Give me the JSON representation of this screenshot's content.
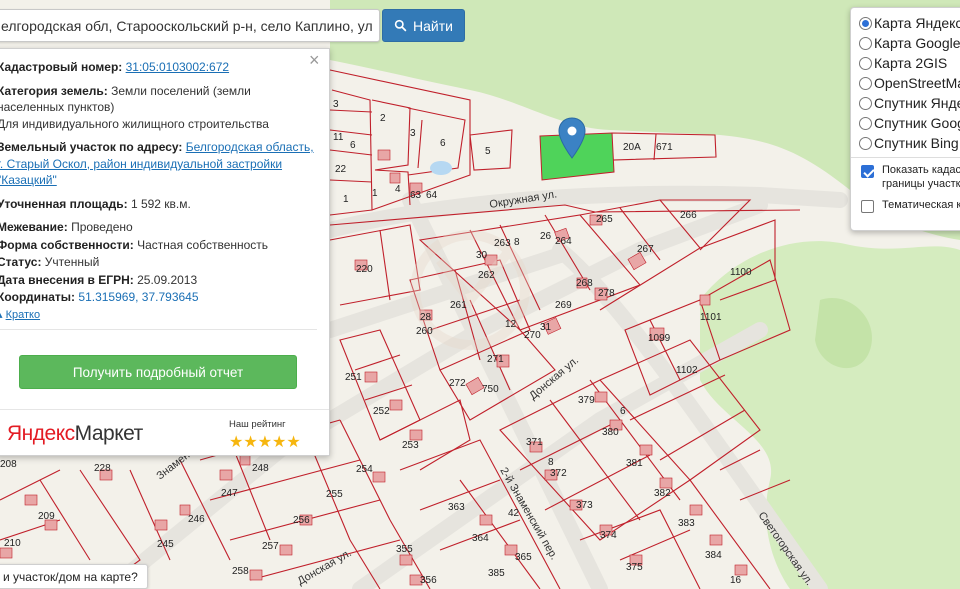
{
  "search": {
    "value": "елгородская обл, Старооскольский р-н, село Каплино, ул",
    "button_label": "Найти"
  },
  "info": {
    "cadastral_label": "Кадастровый номер:",
    "cadastral_value": "31:05:0103002:672",
    "category_label": "Категория земель:",
    "category_value": "Земли поселений (земли",
    "category_value2": "населенных пунктов)",
    "purpose_value": "Для индивидуального жилищного строительства",
    "address_label": "Земельный участок по адресу:",
    "address_line1": "Белгородская область,",
    "address_line2": "г. Старый Оскол, район индивидуальной застройки",
    "address_line3": "\"Казацкий\"",
    "area_label": "Уточненная площадь:",
    "area_value": "1 592 кв.м.",
    "survey_label": "Межевание:",
    "survey_value": "Проведено",
    "ownership_label": "Форма собственности:",
    "ownership_value": "Частная собственность",
    "status_label": "Статус:",
    "status_value": "Учтенный",
    "date_label": "Дата внесения в ЕГРН:",
    "date_value": "25.09.2013",
    "coords_label": "Координаты:",
    "coords_value": "51.315969, 37.793645",
    "brief_label": "Кратко",
    "report_button": "Получить подробный отчет",
    "market_brand_red": "Яндекс",
    "market_brand_dark": "Маркет",
    "rating_label": "Наш рейтинг",
    "rating_value": 5,
    "stars": "★★★★★"
  },
  "layers": {
    "options": [
      {
        "label": "Карта Яндекс",
        "selected": true
      },
      {
        "label": "Карта Google",
        "selected": false
      },
      {
        "label": "Карта 2GIS",
        "selected": false
      },
      {
        "label": "OpenStreetMap",
        "selected": false
      },
      {
        "label": "Спутник Яндекс",
        "selected": false
      },
      {
        "label": "Спутник Google",
        "selected": false
      },
      {
        "label": "Спутник Bing",
        "selected": false
      }
    ],
    "cadastral_check_line1": "Показать кадастровые",
    "cadastral_check_line2": "границы участков",
    "cadastral_checked": true,
    "thematic_check": "Тематическая карта",
    "thematic_checked": false
  },
  "map": {
    "streets": {
      "okruzhnaya": "Окружная ул.",
      "donskaya": "Донская ул.",
      "donskaya2": "Донская ул.",
      "znamenskiy": "2-й Знаменский пер.",
      "znamen_left": "Знамен",
      "svetogorskaya": "Светогорская ул."
    },
    "highlight_color": "#4fd35a",
    "boundary_color": "#c0202b",
    "parcel_numbers": [
      "3",
      "2",
      "3",
      "6",
      "5",
      "11",
      "6",
      "22",
      "1",
      "4",
      "1",
      "63",
      "64",
      "671",
      "20А",
      "265",
      "266",
      "264",
      "263",
      "262",
      "267",
      "220",
      "268",
      "278",
      "1100",
      "260",
      "261",
      "269",
      "28",
      "270",
      "31",
      "1101",
      "251",
      "271",
      "272",
      "750",
      "1099",
      "1102",
      "379",
      "252",
      "380",
      "253",
      "371",
      "372",
      "381",
      "228",
      "248",
      "247",
      "254",
      "255",
      "382",
      "208",
      "209",
      "246",
      "245",
      "256",
      "363",
      "373",
      "383",
      "210",
      "257",
      "374",
      "384",
      "258",
      "355",
      "364",
      "365",
      "375",
      "356",
      "385",
      "16",
      "42",
      "8",
      "6",
      "12",
      "8",
      "30",
      "26"
    ],
    "question": "и участок/дом на карте?"
  }
}
